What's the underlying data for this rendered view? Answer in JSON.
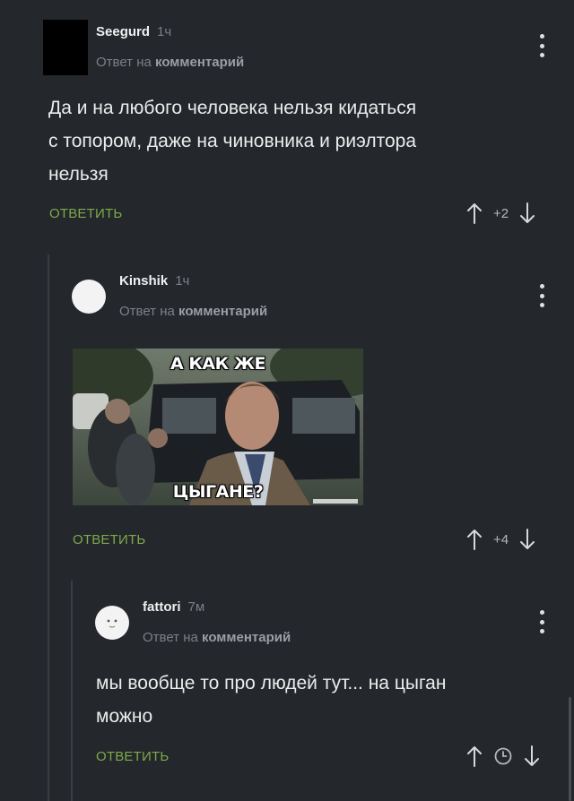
{
  "common": {
    "reply_to_prefix": "Ответ на",
    "reply_to_target": "комментарий",
    "reply_button": "ОТВЕТИТЬ"
  },
  "comments": [
    {
      "username": "Seegurd",
      "time": "1ч",
      "text_lines": [
        "Да и на любого человека нельзя кидаться",
        "с топором, даже на чиновника и риэлтора",
        "нельзя"
      ],
      "rating": "+2"
    },
    {
      "username": "Kinshik",
      "time": "1ч",
      "image": {
        "caption_top": "А КАК ЖЕ",
        "caption_bottom": "ЦЫГАНЕ?"
      },
      "rating": "+4"
    },
    {
      "username": "fattori",
      "time": "7м",
      "text_lines": [
        "мы вообще то про людей тут... на цыган",
        "можно"
      ],
      "rating_icon": "clock-icon"
    }
  ],
  "colors": {
    "background": "#24272c",
    "reply_button": "#7fa94a",
    "muted": "#7c8087"
  }
}
